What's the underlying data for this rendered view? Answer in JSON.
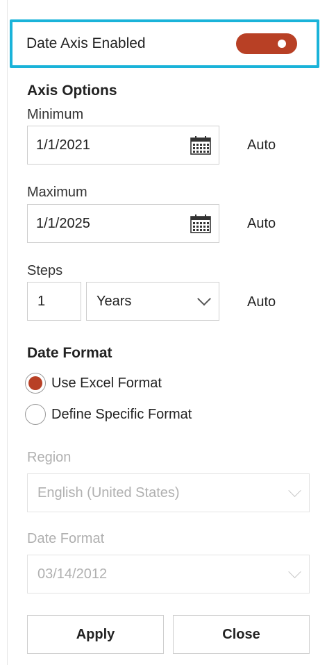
{
  "toggle": {
    "label": "Date Axis Enabled",
    "enabled": true,
    "color": "#b84025"
  },
  "axis_options": {
    "title": "Axis Options",
    "minimum": {
      "label": "Minimum",
      "value": "1/1/2021",
      "auto_label": "Auto"
    },
    "maximum": {
      "label": "Maximum",
      "value": "1/1/2025",
      "auto_label": "Auto"
    },
    "steps": {
      "label": "Steps",
      "value": "1",
      "unit": "Years",
      "auto_label": "Auto"
    }
  },
  "date_format": {
    "title": "Date Format",
    "options": [
      {
        "label": "Use Excel Format",
        "selected": true
      },
      {
        "label": "Define Specific Format",
        "selected": false
      }
    ],
    "region": {
      "label": "Region",
      "value": "English (United States)",
      "disabled": true
    },
    "format": {
      "label": "Date Format",
      "value": "03/14/2012",
      "disabled": true
    }
  },
  "buttons": {
    "apply": "Apply",
    "close": "Close"
  },
  "accent_color": "#1ab3d9"
}
